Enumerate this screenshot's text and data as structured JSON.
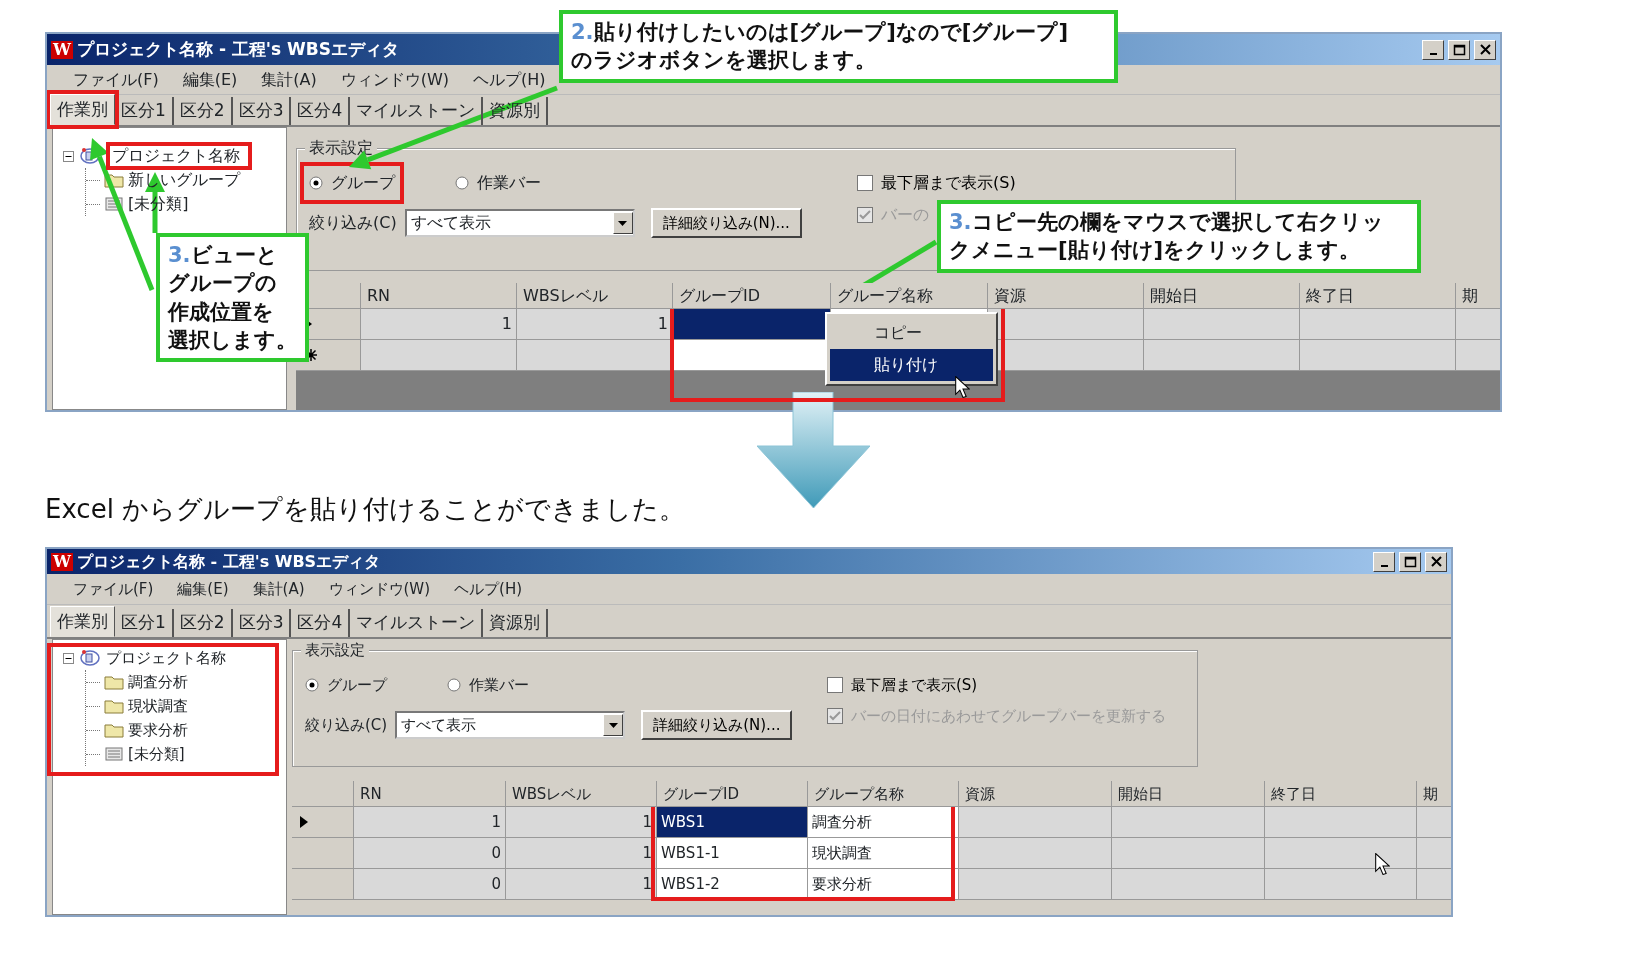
{
  "windows": [
    {
      "logo": "W",
      "title": "プロジェクト名称 - 工程's WBSエディタ",
      "menu": [
        "ファイル(F)",
        "編集(E)",
        "集計(A)",
        "ウィンドウ(W)",
        "ヘルプ(H)"
      ],
      "tabs": [
        {
          "label": "作業別",
          "selected": true
        },
        {
          "label": "区分1",
          "selected": false
        },
        {
          "label": "区分2",
          "selected": false
        },
        {
          "label": "区分3",
          "selected": false
        },
        {
          "label": "区分4",
          "selected": false
        },
        {
          "label": "マイルストーン",
          "selected": false
        },
        {
          "label": "資源別",
          "selected": false
        }
      ],
      "tree": {
        "label": "プロジェクト名称",
        "expanded": true,
        "children": [
          {
            "label": "新しいグループ",
            "kind": "folder"
          },
          {
            "label": "[未分類]",
            "kind": "list"
          }
        ]
      },
      "settings": {
        "title": "表示設定",
        "radios": [
          {
            "label": "グループ",
            "selected": true
          },
          {
            "label": "作業バー",
            "selected": false
          }
        ],
        "checkboxes": [
          {
            "label": "最下層まで表示(S)",
            "checked": false,
            "disabled": false
          },
          {
            "label": "バーの",
            "checked": true,
            "disabled": true
          }
        ],
        "filter_label": "絞り込み(C)",
        "filter_value": "すべて表示",
        "detail_button": "詳細絞り込み(N)..."
      },
      "grid": {
        "columns": [
          {
            "label": "RN",
            "editable": false
          },
          {
            "label": "WBSレベル",
            "editable": false
          },
          {
            "label": "グループID",
            "editable": true
          },
          {
            "label": "グループ名称",
            "editable": true
          },
          {
            "label": "資源",
            "editable": false
          },
          {
            "label": "開始日",
            "editable": false
          },
          {
            "label": "終了日",
            "editable": false
          },
          {
            "label": "期",
            "editable": false
          }
        ],
        "rows": [
          {
            "kind": "current",
            "selected": true,
            "values": [
              "1",
              "1"
            ]
          },
          {
            "kind": "new",
            "selected": false
          }
        ]
      },
      "context_menu": [
        {
          "label": "コピー",
          "selected": false
        },
        {
          "label": "貼り付け",
          "selected": true
        }
      ]
    },
    {
      "logo": "W",
      "title": "プロジェクト名称 - 工程's WBSエディタ",
      "menu": [
        "ファイル(F)",
        "編集(E)",
        "集計(A)",
        "ウィンドウ(W)",
        "ヘルプ(H)"
      ],
      "tabs": [
        {
          "label": "作業別",
          "selected": true
        },
        {
          "label": "区分1",
          "selected": false
        },
        {
          "label": "区分2",
          "selected": false
        },
        {
          "label": "区分3",
          "selected": false
        },
        {
          "label": "区分4",
          "selected": false
        },
        {
          "label": "マイルストーン",
          "selected": false
        },
        {
          "label": "資源別",
          "selected": false
        }
      ],
      "tree": {
        "label": "プロジェクト名称",
        "expanded": true,
        "children": [
          {
            "label": "調査分析",
            "kind": "folder"
          },
          {
            "label": "現状調査",
            "kind": "folder"
          },
          {
            "label": "要求分析",
            "kind": "folder"
          },
          {
            "label": "[未分類]",
            "kind": "list"
          }
        ]
      },
      "settings": {
        "title": "表示設定",
        "radios": [
          {
            "label": "グループ",
            "selected": true
          },
          {
            "label": "作業バー",
            "selected": false
          }
        ],
        "checkboxes": [
          {
            "label": "最下層まで表示(S)",
            "checked": false,
            "disabled": false
          },
          {
            "label": "バーの日付にあわせてグループバーを更新する",
            "checked": true,
            "disabled": true
          }
        ],
        "filter_label": "絞り込み(C)",
        "filter_value": "すべて表示",
        "detail_button": "詳細絞り込み(N)..."
      },
      "grid": {
        "columns": [
          {
            "label": "RN",
            "editable": false
          },
          {
            "label": "WBSレベル",
            "editable": false
          },
          {
            "label": "グループID",
            "editable": true
          },
          {
            "label": "グループ名称",
            "editable": true
          },
          {
            "label": "資源",
            "editable": false
          },
          {
            "label": "開始日",
            "editable": false
          },
          {
            "label": "終了日",
            "editable": false
          },
          {
            "label": "期",
            "editable": false
          }
        ],
        "rows": [
          {
            "kind": "current",
            "selected": true,
            "values": [
              "1",
              "1",
              "WBS1",
              "調査分析"
            ]
          },
          {
            "kind": "normal",
            "selected": false,
            "values": [
              "0",
              "1",
              "WBS1-1",
              "現状調査"
            ]
          },
          {
            "kind": "normal",
            "selected": false,
            "values": [
              "0",
              "1",
              "WBS1-2",
              "要求分析"
            ]
          }
        ]
      }
    }
  ],
  "callouts": [
    {
      "number": "2.",
      "lines": [
        "貼り付けしたいのは[グループ]なので[グループ]",
        "のラジオボタンを選択します。"
      ]
    },
    {
      "number": "3.",
      "lines": [
        "ビューと",
        "グループの",
        "作成位置を",
        "選択します。"
      ]
    },
    {
      "number": "3.",
      "lines": [
        "コピー先の欄をマウスで選択して右クリッ",
        "クメニュー[貼り付け]をクリックします。"
      ]
    }
  ],
  "caption": "Excel からグループを貼り付けることができました。"
}
